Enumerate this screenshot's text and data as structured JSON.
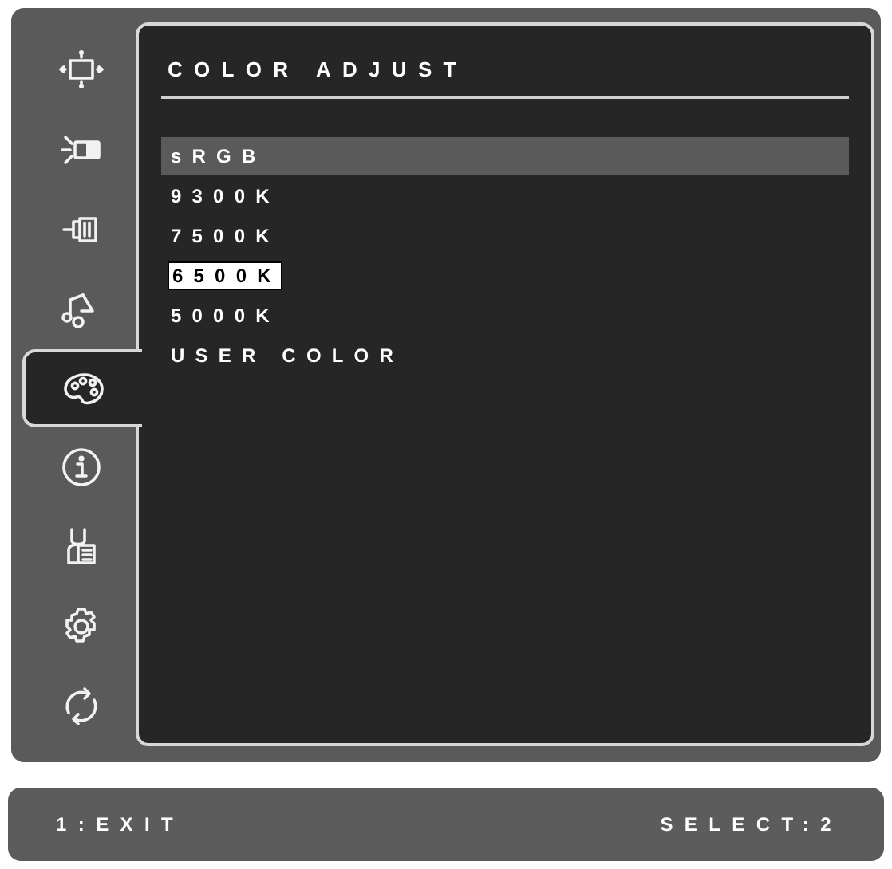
{
  "sidebar": {
    "items": [
      {
        "selected": false
      },
      {
        "selected": false
      },
      {
        "selected": false
      },
      {
        "selected": false
      },
      {
        "selected": true
      },
      {
        "selected": false
      },
      {
        "selected": false
      },
      {
        "selected": false
      },
      {
        "selected": false
      }
    ]
  },
  "menu": {
    "title": "COLOR ADJUST",
    "items": [
      {
        "label": "sRGB",
        "selected": true,
        "current": false
      },
      {
        "label": "9300K",
        "selected": false,
        "current": false
      },
      {
        "label": "7500K",
        "selected": false,
        "current": false
      },
      {
        "label": "6500K",
        "selected": false,
        "current": true
      },
      {
        "label": "5000K",
        "selected": false,
        "current": false
      },
      {
        "label": "USER COLOR",
        "selected": false,
        "current": false
      }
    ]
  },
  "footer": {
    "left": "1:EXIT",
    "right": "SELECT:2"
  }
}
